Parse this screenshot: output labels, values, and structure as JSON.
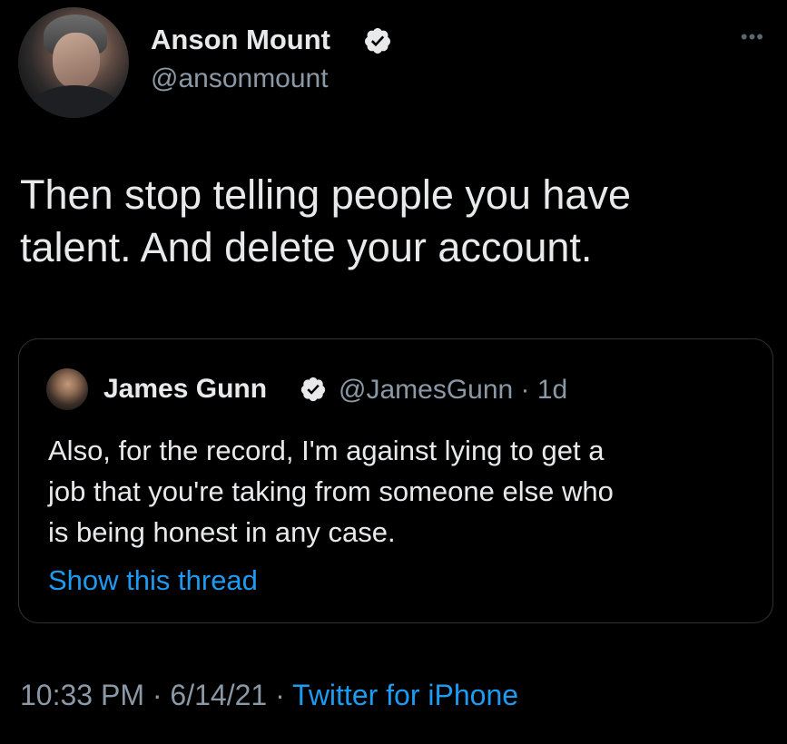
{
  "author": {
    "display_name": "Anson Mount",
    "handle": "@ansonmount",
    "verified": true
  },
  "more_icon": "more-horizontal-icon",
  "more_glyph": "•••",
  "tweet": {
    "text": "Then stop telling people you have\ntalent. And delete your account."
  },
  "quoted_tweet": {
    "display_name": "James Gunn",
    "handle_time": "@JamesGunn · 1d",
    "verified": true,
    "text": "Also, for the record, I'm against lying to get a\njob that you're taking from someone else who\nis being honest in any case.",
    "show_thread_label": "Show this thread"
  },
  "meta": {
    "time_date": "10:33 PM · 6/14/21 · ",
    "source": "Twitter for iPhone"
  },
  "colors": {
    "background": "#000000",
    "text": "#e7e9ea",
    "secondary": "#8b98a5",
    "link": "#1d9bf0",
    "border": "#2f3336"
  }
}
